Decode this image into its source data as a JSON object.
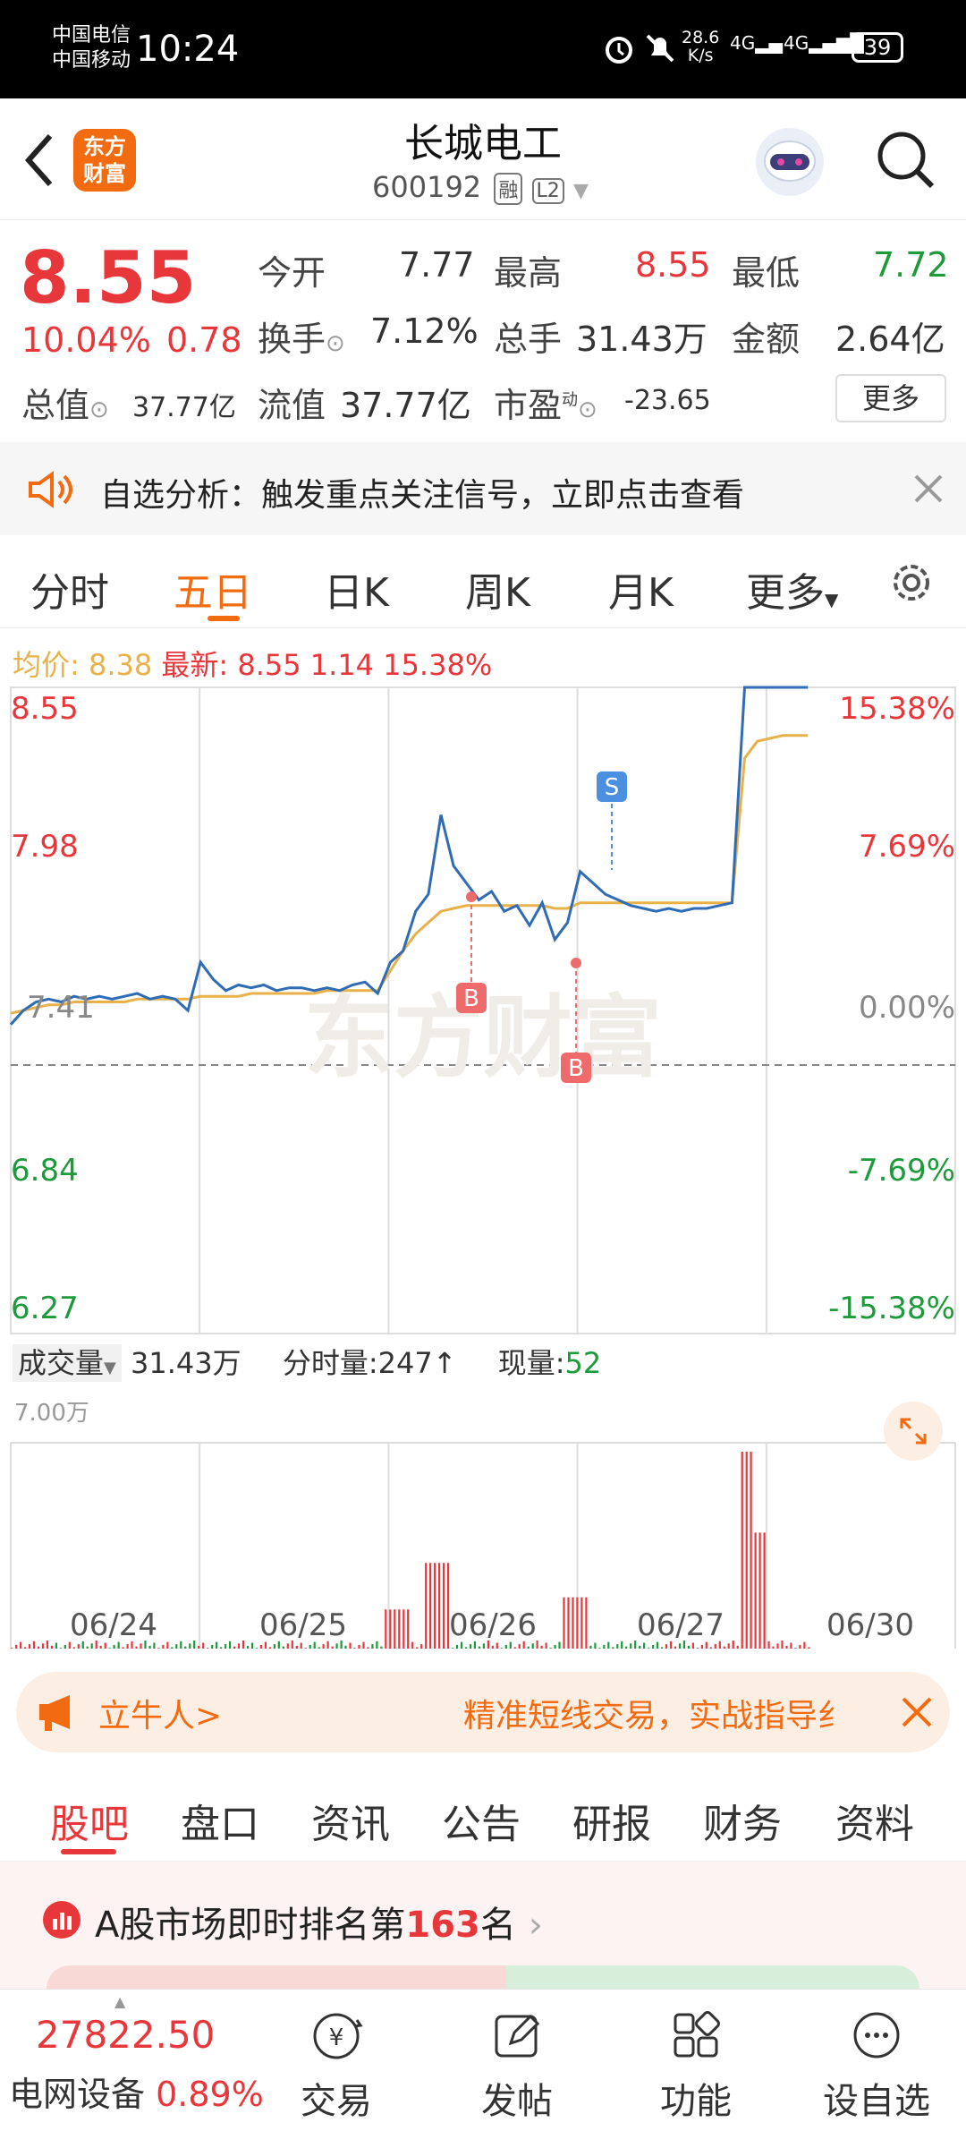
{
  "status_bar": {
    "carrier1": "中国电信",
    "carrier2": "中国移动",
    "time": "10:24",
    "net_speed": "28.6",
    "net_unit": "K/s",
    "sig1": "4G",
    "sig2": "4G",
    "battery": "39"
  },
  "header": {
    "brand_line1": "东方",
    "brand_line2": "财富",
    "stock_name": "长城电工",
    "stock_code": "600192",
    "badge_rong": "融",
    "badge_l2": "L2"
  },
  "quote": {
    "price": "8.55",
    "change_pct": "10.04%",
    "change_abs": "0.78",
    "open_label": "今开",
    "open": "7.77",
    "high_label": "最高",
    "high": "8.55",
    "low_label": "最低",
    "low": "7.72",
    "turnover_label": "换手",
    "turnover": "7.12%",
    "vol_label": "总手",
    "vol": "31.43万",
    "amount_label": "金额",
    "amount": "2.64亿",
    "mktcap_label": "总值",
    "mktcap": "37.77亿",
    "float_label": "流值",
    "float": "37.77亿",
    "pe_label": "市盈",
    "pe_sup": "动",
    "pe": "-23.65",
    "more_btn": "更多"
  },
  "alert": {
    "text": "自选分析：触发重点关注信号，立即点击查看"
  },
  "tabs": [
    "分时",
    "五日",
    "日K",
    "周K",
    "月K",
    "更多"
  ],
  "tabs_active": "五日",
  "legend": {
    "avg_label": "均价:",
    "avg_value": "8.38",
    "latest_label": "最新:",
    "latest_price": "8.55",
    "latest_chg": "1.14",
    "latest_pct": "15.38%"
  },
  "axes": {
    "y_left": [
      "8.55",
      "7.98",
      "6.84",
      "6.27"
    ],
    "y_right": [
      "15.38%",
      "7.69%",
      "0.00%",
      "-7.69%",
      "-15.38%"
    ],
    "base_left": "7.41",
    "x_dates": [
      "06/24",
      "06/25",
      "06/26",
      "06/27",
      "06/30"
    ]
  },
  "watermark": "东方财富",
  "markers": {
    "b": "B",
    "s": "S"
  },
  "volume": {
    "label": "成交量",
    "total": "31.43万",
    "tick_label": "分时量:",
    "tick_value": "247",
    "tick_arrow": "↑",
    "now_label": "现量:",
    "now_value": "52",
    "max_label": "7.00万"
  },
  "promo": {
    "left": "立牛人>",
    "right": "精准短线交易，实战指导纟"
  },
  "subtabs": [
    "股吧",
    "盘口",
    "资讯",
    "公告",
    "研报",
    "财务",
    "资料"
  ],
  "subtabs_active": "股吧",
  "rank": {
    "prefix": "A股市场即时排名第",
    "number": "163",
    "suffix": "名"
  },
  "bottom": {
    "index_value": "27822.50",
    "sector_name": "电网设备",
    "sector_pct": "0.89%",
    "btn_trade": "交易",
    "btn_post": "发帖",
    "btn_func": "功能",
    "btn_watch": "设自选"
  },
  "colors": {
    "up": "#e8373b",
    "down": "#1d9a3a",
    "accent": "#f26b10",
    "price_line": "#2f6cb5",
    "avg_line": "#e8b14a"
  },
  "chart_data": {
    "type": "line",
    "x_days": [
      "06/24",
      "06/25",
      "06/26",
      "06/27",
      "06/30"
    ],
    "ylim": [
      6.27,
      8.55
    ],
    "pre_close": 7.41,
    "series": [
      {
        "name": "最新",
        "values": [
          7.36,
          7.41,
          7.44,
          7.45,
          7.44,
          7.46,
          7.45,
          7.46,
          7.45,
          7.46,
          7.47,
          7.45,
          7.46,
          7.45,
          7.41,
          7.58,
          7.52,
          7.48,
          7.5,
          7.49,
          7.5,
          7.48,
          7.49,
          7.49,
          7.48,
          7.49,
          7.48,
          7.5,
          7.51,
          7.47,
          7.58,
          7.62,
          7.76,
          7.82,
          8.1,
          7.92,
          7.86,
          7.8,
          7.83,
          7.76,
          7.78,
          7.71,
          7.79,
          7.66,
          7.72,
          7.9,
          7.86,
          7.82,
          7.8,
          7.78,
          7.77,
          7.76,
          7.77,
          7.76,
          7.77,
          7.77,
          7.78,
          7.79,
          8.55,
          8.55,
          8.55,
          8.55,
          8.55,
          8.55
        ]
      },
      {
        "name": "均价",
        "values": [
          7.4,
          7.41,
          7.42,
          7.43,
          7.43,
          7.44,
          7.44,
          7.44,
          7.44,
          7.44,
          7.45,
          7.45,
          7.45,
          7.45,
          7.45,
          7.46,
          7.46,
          7.46,
          7.46,
          7.47,
          7.47,
          7.47,
          7.47,
          7.47,
          7.47,
          7.48,
          7.48,
          7.48,
          7.48,
          7.48,
          7.55,
          7.62,
          7.68,
          7.72,
          7.76,
          7.77,
          7.78,
          7.78,
          7.78,
          7.78,
          7.78,
          7.78,
          7.78,
          7.77,
          7.77,
          7.79,
          7.79,
          7.79,
          7.79,
          7.79,
          7.79,
          7.79,
          7.79,
          7.79,
          7.79,
          7.79,
          7.79,
          7.79,
          8.3,
          8.36,
          8.37,
          8.38,
          8.38,
          8.38
        ]
      }
    ],
    "volume_max": 70000
  }
}
